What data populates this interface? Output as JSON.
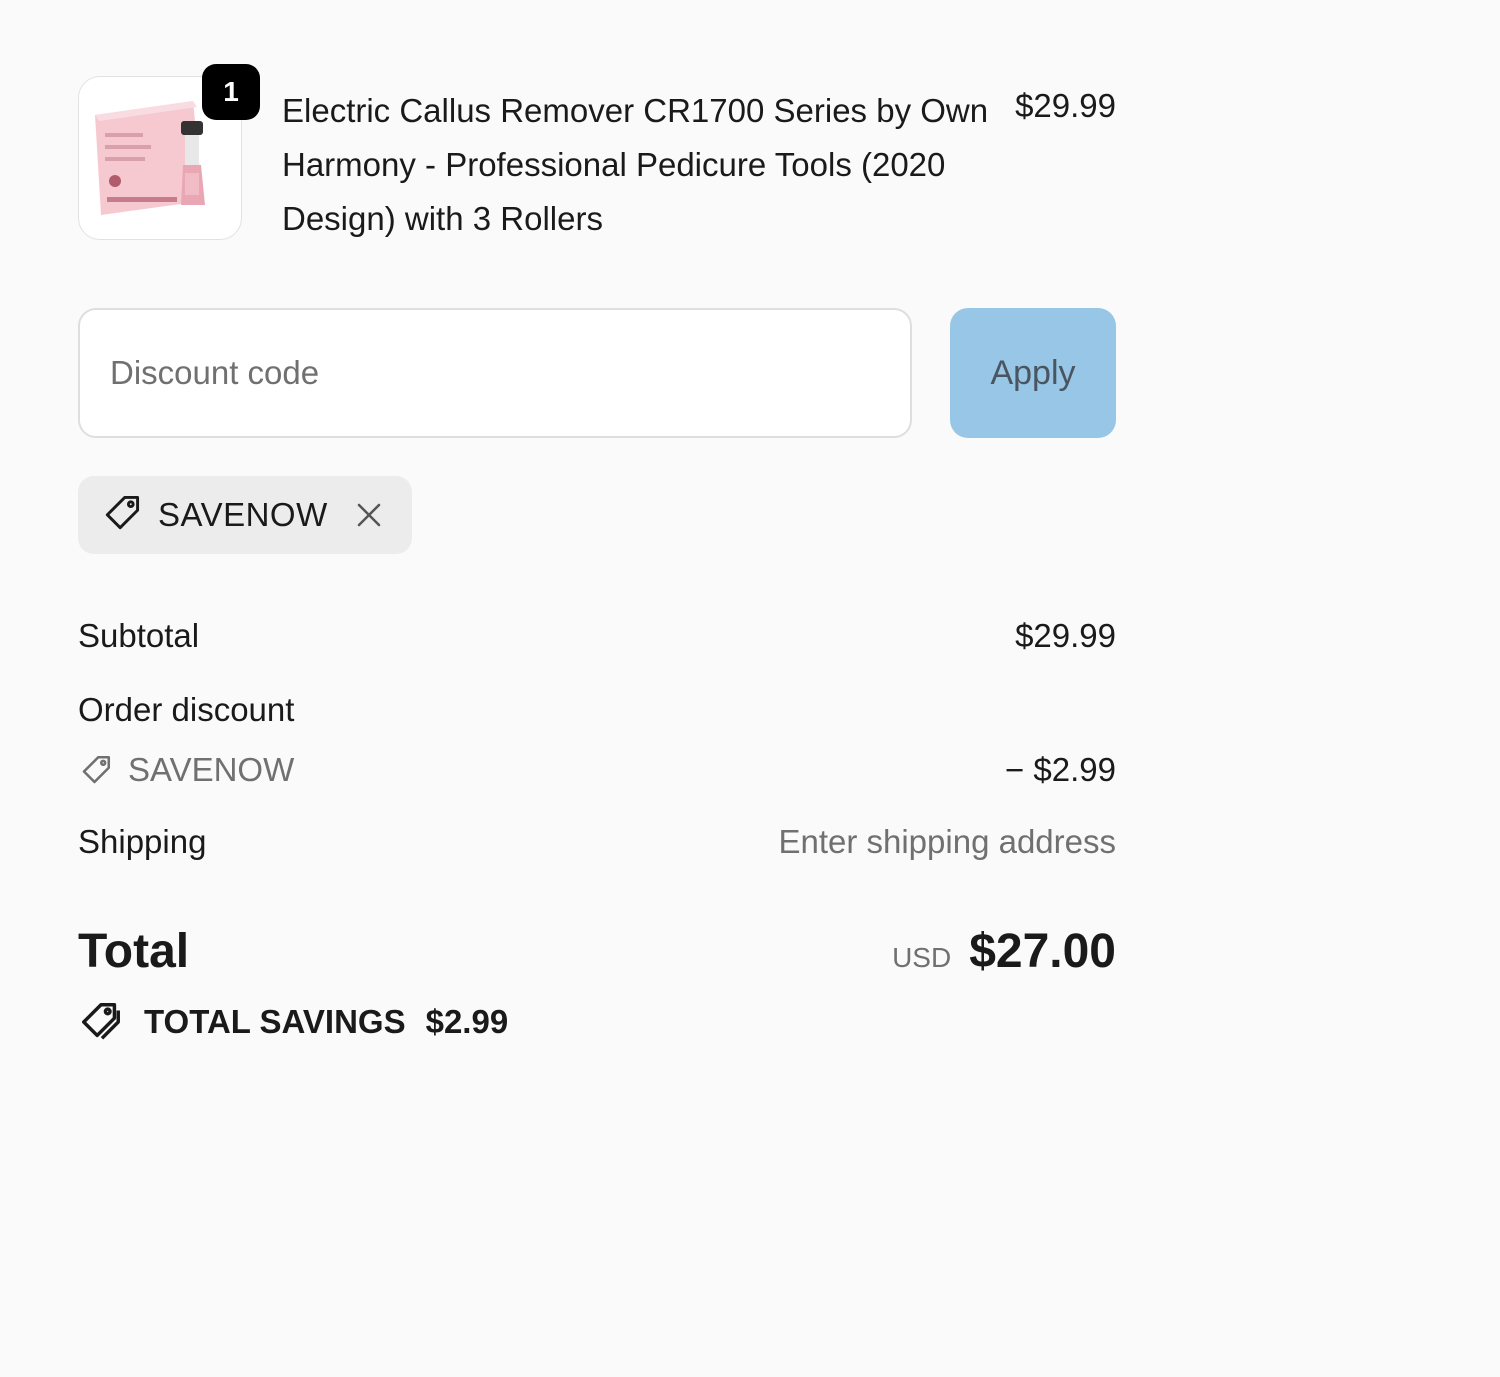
{
  "product": {
    "quantity": "1",
    "title": "Electric Callus Remover CR1700 Series by Own Harmony - Professional Pedicure Tools (2020 Design) with 3 Rollers",
    "price": "$29.99",
    "image_icon": "product-thumbnail-pink-box"
  },
  "discount": {
    "placeholder": "Discount code",
    "apply_label": "Apply",
    "applied_code": "SAVENOW"
  },
  "totals": {
    "subtotal_label": "Subtotal",
    "subtotal_value": "$29.99",
    "order_discount_label": "Order discount",
    "order_discount_code": "SAVENOW",
    "order_discount_value": "− $2.99",
    "shipping_label": "Shipping",
    "shipping_value": "Enter shipping address",
    "total_label": "Total",
    "currency": "USD",
    "total_value": "$27.00",
    "savings_label": "TOTAL SAVINGS",
    "savings_value": "$2.99"
  },
  "colors": {
    "apply_button_bg": "#97c6e6",
    "badge_bg": "#000000",
    "page_bg": "#fafafa"
  }
}
